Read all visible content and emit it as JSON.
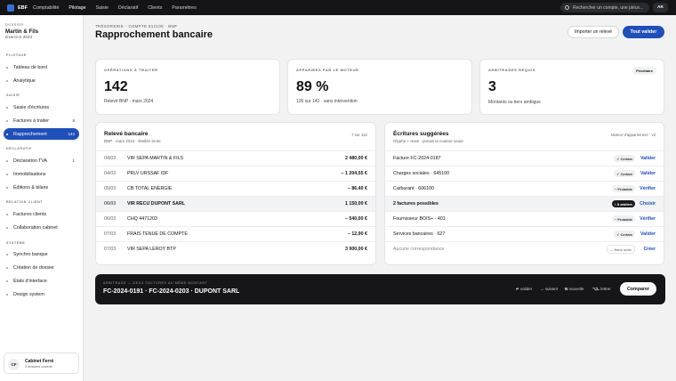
{
  "topbar": {
    "brand": "EBF",
    "nav": [
      "Comptabilité",
      "Pilotage",
      "Saisie",
      "Déclaratif",
      "Clients",
      "Paramètres"
    ],
    "search_placeholder": "Rechercher un compte, une pièce...",
    "avatar": "AK"
  },
  "sidebar": {
    "dossier_label": "DOSSIER",
    "dossier_name": "Martin & Fils",
    "exercice": "Exercice 2024",
    "sections": {
      "pilotage": "PILOTAGE",
      "saisie": "SAISIE",
      "declaratif": "DÉCLARATIF",
      "relation": "RELATION CLIENT",
      "systeme": "SYSTÈME"
    },
    "items": [
      {
        "label": "Tableau de bord",
        "count": ""
      },
      {
        "label": "Analytique",
        "count": ""
      },
      {
        "label": "Saisie d'écritures",
        "count": ""
      },
      {
        "label": "Factures à traiter",
        "count": "8"
      },
      {
        "label": "Rapprochement",
        "count": "142"
      },
      {
        "label": "Déclaration TVA",
        "count": "1"
      },
      {
        "label": "Immobilisations",
        "count": ""
      },
      {
        "label": "Éditions & bilans",
        "count": ""
      },
      {
        "label": "Factures clients",
        "count": ""
      },
      {
        "label": "Collaboration cabinet",
        "count": ""
      },
      {
        "label": "Synchro banque",
        "count": ""
      },
      {
        "label": "Création de dossier",
        "count": ""
      },
      {
        "label": "États d'interface",
        "count": ""
      },
      {
        "label": "Design system",
        "count": ""
      }
    ],
    "cabinet": {
      "initials": "CF",
      "name": "Cabinet Ferré",
      "sub": "3 dossiers ouverts"
    }
  },
  "header": {
    "breadcrumb": "TRÉSORERIE · COMPTE 512100 · BNP",
    "title": "Rapprochement bancaire",
    "import_label": "Importer un relevé",
    "validate_label": "Tout valider"
  },
  "kpis": [
    {
      "label": "OPÉRATIONS À TRAITER",
      "value": "142",
      "sub": "Relevé BNP · mars 2024",
      "badge": ""
    },
    {
      "label": "APPARIEES PAR LE MOTEUR",
      "value": "89 %",
      "sub": "126 sur 142 · sans intervention",
      "badge": ""
    },
    {
      "label": "ARBITRAGES REQUIS",
      "value": "3",
      "sub": "Montants ou tiers ambigus",
      "badge": "Prioritaire"
    }
  ],
  "releve": {
    "title": "Relevé bancaire",
    "subtitle": "BNP · mars 2024 · libellés bruts",
    "position": "7 sur 142",
    "rows": [
      {
        "date": "04/03",
        "label": "VIR SEPA MARTIN & FILS",
        "amount": "2 480,00 €"
      },
      {
        "date": "04/03",
        "label": "PRLV URSSAF IDF",
        "amount": "− 1 204,55 €"
      },
      {
        "date": "05/03",
        "label": "CB TOTAL ENERGIE",
        "amount": "− 86,40 €"
      },
      {
        "date": "06/03",
        "label": "VIR RECU DUPONT SARL",
        "amount": "1 150,00 €"
      },
      {
        "date": "06/03",
        "label": "CHQ 4471203",
        "amount": "− 540,00 €"
      },
      {
        "date": "07/03",
        "label": "FRAIS TENUE DE COMPTE",
        "amount": "− 12,90 €"
      },
      {
        "date": "07/03",
        "label": "VIR SEPA LEROY BTP",
        "amount": "3 900,00 €"
      }
    ]
  },
  "suggestions": {
    "title": "Écritures suggérées",
    "subtitle": "Glyphe + texte · jamais la couleur seule",
    "engine": "Moteur d'appariement · v3",
    "rows": [
      {
        "label": "Facture FC-2024-0187",
        "tag": "✓ Certain",
        "action": "Valider"
      },
      {
        "label": "Charges sociales · 645100",
        "tag": "✓ Certain",
        "action": "Valider"
      },
      {
        "label": "Carburant · 606100",
        "tag": "~ Probable",
        "action": "Vérifier"
      },
      {
        "label": "2 factures possibles",
        "tag": "! À arbitrer",
        "action": "Choisir"
      },
      {
        "label": "Fournisseur BOIS+ · 401",
        "tag": "~ Probable",
        "action": "Vérifier"
      },
      {
        "label": "Services bancaires · 627",
        "tag": "✓ Certain",
        "action": "Valider"
      },
      {
        "label": "Aucune correspondance",
        "tag": "— Sans suite",
        "action": "Créer"
      }
    ]
  },
  "arbitrage": {
    "label": "ARBITRAGE — DEUX FACTURES AU MÊME MONTANT",
    "title": "FC-2024-0191 · FC-2024-0203 · DUPONT SARL",
    "shortcuts": [
      {
        "key": "↵",
        "label": "valider"
      },
      {
        "key": "→",
        "label": "suivant"
      },
      {
        "key": "N",
        "label": "nouvelle"
      },
      {
        "key": "⌥L",
        "label": "lettrer"
      }
    ],
    "compare_label": "Comparer"
  },
  "colors": {
    "accent": "#1f4fb8",
    "dark": "#141416"
  }
}
